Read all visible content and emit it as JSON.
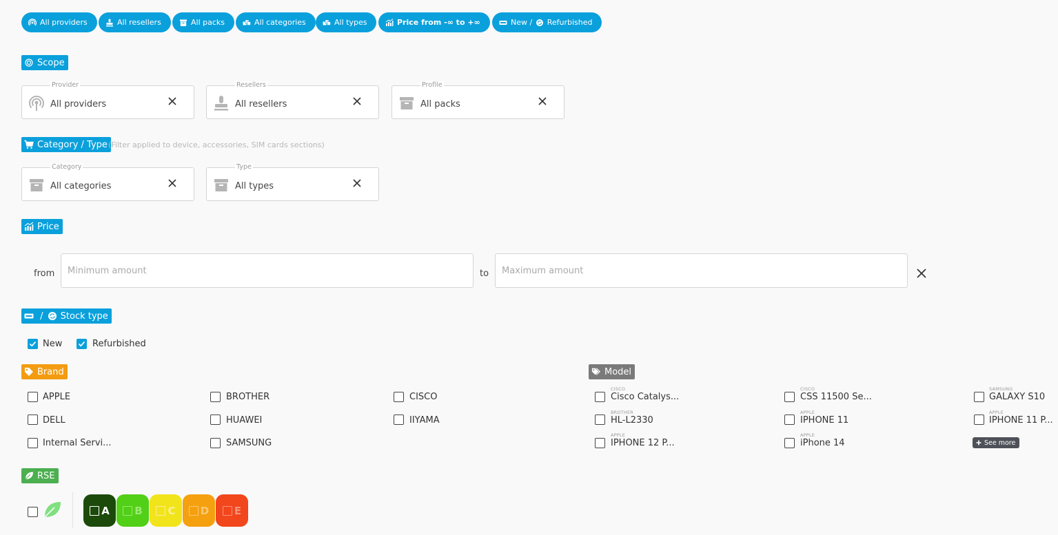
{
  "chips": {
    "providers": "All providers",
    "resellers": "All resellers",
    "packs": "All packs",
    "categories": "All categories",
    "types": "All types",
    "price": "Price from -∞ to +∞",
    "stock_new": "New",
    "stock_sep": " / ",
    "stock_refurb": "Refurbished"
  },
  "scope": {
    "title": "Scope",
    "provider": {
      "label": "Provider",
      "value": "All providers"
    },
    "resellers": {
      "label": "Resellers",
      "value": "All resellers"
    },
    "profile": {
      "label": "Profile",
      "value": "All packs"
    }
  },
  "category_type": {
    "title": "Category / Type",
    "note": "(Filter applied to device, accessories, SIM cards sections)",
    "category": {
      "label": "Category",
      "value": "All categories"
    },
    "type": {
      "label": "Type",
      "value": "All types"
    }
  },
  "price": {
    "title": "Price",
    "from_label": "from",
    "to_label": "to",
    "min_placeholder": "Minimum amount",
    "max_placeholder": "Maximum amount"
  },
  "stock": {
    "title_sep": " / ",
    "title": "Stock type",
    "new_label": "New",
    "new_checked": true,
    "refurb_label": "Refurbished",
    "refurb_checked": true
  },
  "brand": {
    "title": "Brand",
    "items": [
      "APPLE",
      "BROTHER",
      "CISCO",
      "DELL",
      "HUAWEI",
      "IIYAMA",
      "Internal Servi...",
      "SAMSUNG"
    ]
  },
  "model": {
    "title": "Model",
    "items": [
      {
        "brand": "CISCO",
        "name": "Cisco Catalys..."
      },
      {
        "brand": "CISCO",
        "name": "CSS 11500 Se..."
      },
      {
        "brand": "SAMSUNG",
        "name": "GALAXY S10"
      },
      {
        "brand": "BROTHER",
        "name": "HL-L2330"
      },
      {
        "brand": "APPLE",
        "name": "IPHONE 11"
      },
      {
        "brand": "APPLE",
        "name": "IPHONE 11 P..."
      },
      {
        "brand": "APPLE",
        "name": "IPHONE 12 P..."
      },
      {
        "brand": "APPLE",
        "name": "iPhone 14"
      }
    ],
    "see_more": "See more"
  },
  "rse": {
    "title": "RSE",
    "scores": [
      {
        "grade": "A",
        "bg": "#1b4a0b",
        "fg": "#ffffff"
      },
      {
        "grade": "B",
        "bg": "#52d017",
        "fg": "#9be873"
      },
      {
        "grade": "C",
        "bg": "#f2e41a",
        "fg": "#f7f09a"
      },
      {
        "grade": "D",
        "bg": "#f5a00f",
        "fg": "#f9c873"
      },
      {
        "grade": "E",
        "bg": "#f2461c",
        "fg": "#f7947d"
      }
    ]
  },
  "colors": {
    "accent": "#0aa0dc",
    "brand_tag": "#f39c12",
    "model_tag": "#7a7a7a",
    "rse_tag": "#4caf50"
  },
  "icons": [
    "broadcast-icon",
    "stamp-icon",
    "archive-box-icon",
    "boxes-icon",
    "chart-icon",
    "new-badge-icon",
    "recycle-icon",
    "target-icon",
    "cart-icon",
    "tag-icon",
    "tags-icon",
    "leaf-icon",
    "close-icon",
    "plus-icon"
  ]
}
